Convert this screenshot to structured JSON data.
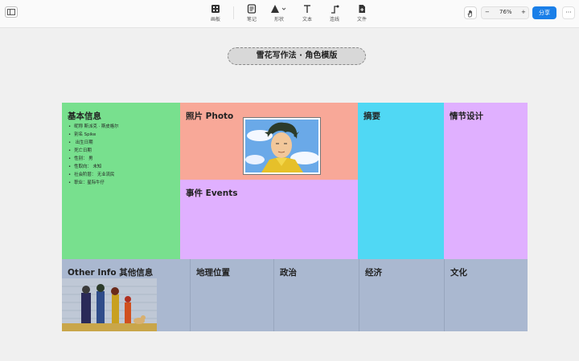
{
  "toolbar": {
    "tools": [
      {
        "label": "画板",
        "icon": "grid-icon"
      },
      {
        "label": "笔记",
        "icon": "note-icon"
      },
      {
        "label": "形状",
        "icon": "shape-icon"
      },
      {
        "label": "文本",
        "icon": "text-icon"
      },
      {
        "label": "连线",
        "icon": "connector-icon"
      },
      {
        "label": "文件",
        "icon": "file-icon"
      }
    ],
    "zoom": "76%",
    "zoom_out": "−",
    "zoom_in": "+",
    "share_label": "分享",
    "more_label": "···"
  },
  "canvas": {
    "title": "雪花写作法 · 角色模版",
    "sections": {
      "basic_info": {
        "heading": "基本信息",
        "items": [
          "昵称 斯派克 · 斯皮格尔",
          "别名 Spike",
          " 出生日期",
          "死亡日期",
          "性别： 男",
          "性取向： 未知",
          "社会阶层： 无业流民",
          "职业：星际牛仔"
        ]
      },
      "photo": {
        "heading": "照片 Photo",
        "image": "spike-portrait"
      },
      "events": {
        "heading": "事件 Events"
      },
      "summary": {
        "heading": "摘要"
      },
      "plot": {
        "heading": "情节设计"
      },
      "other": {
        "heading": "Other Info 其他信息",
        "image": "cast-lineup"
      },
      "geography": {
        "heading": "地理位置"
      },
      "politics": {
        "heading": "政治"
      },
      "economy": {
        "heading": "经济"
      },
      "culture": {
        "heading": "文化"
      }
    }
  },
  "colors": {
    "basic": "#78e08e",
    "photo": "#f8a898",
    "events": "#e0b0ff",
    "summary": "#50d8f4",
    "plot": "#e0b0ff",
    "bottom_row": "#aab8d0",
    "share": "#1a7fe8"
  }
}
